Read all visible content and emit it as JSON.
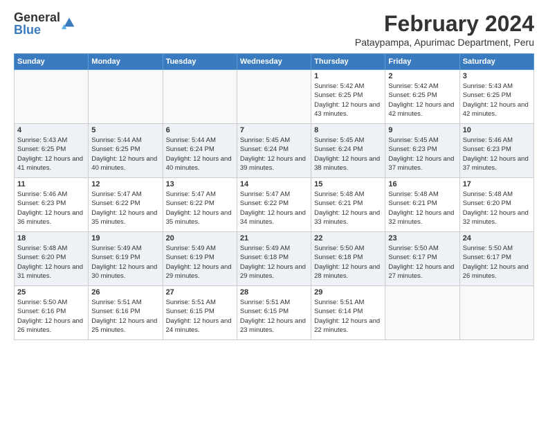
{
  "logo": {
    "general": "General",
    "blue": "Blue"
  },
  "title": "February 2024",
  "location": "Pataypampa, Apurimac Department, Peru",
  "days_of_week": [
    "Sunday",
    "Monday",
    "Tuesday",
    "Wednesday",
    "Thursday",
    "Friday",
    "Saturday"
  ],
  "weeks": [
    [
      {
        "day": "",
        "info": ""
      },
      {
        "day": "",
        "info": ""
      },
      {
        "day": "",
        "info": ""
      },
      {
        "day": "",
        "info": ""
      },
      {
        "day": "1",
        "info": "Sunrise: 5:42 AM\nSunset: 6:25 PM\nDaylight: 12 hours and 43 minutes."
      },
      {
        "day": "2",
        "info": "Sunrise: 5:42 AM\nSunset: 6:25 PM\nDaylight: 12 hours and 42 minutes."
      },
      {
        "day": "3",
        "info": "Sunrise: 5:43 AM\nSunset: 6:25 PM\nDaylight: 12 hours and 42 minutes."
      }
    ],
    [
      {
        "day": "4",
        "info": "Sunrise: 5:43 AM\nSunset: 6:25 PM\nDaylight: 12 hours and 41 minutes."
      },
      {
        "day": "5",
        "info": "Sunrise: 5:44 AM\nSunset: 6:25 PM\nDaylight: 12 hours and 40 minutes."
      },
      {
        "day": "6",
        "info": "Sunrise: 5:44 AM\nSunset: 6:24 PM\nDaylight: 12 hours and 40 minutes."
      },
      {
        "day": "7",
        "info": "Sunrise: 5:45 AM\nSunset: 6:24 PM\nDaylight: 12 hours and 39 minutes."
      },
      {
        "day": "8",
        "info": "Sunrise: 5:45 AM\nSunset: 6:24 PM\nDaylight: 12 hours and 38 minutes."
      },
      {
        "day": "9",
        "info": "Sunrise: 5:45 AM\nSunset: 6:23 PM\nDaylight: 12 hours and 37 minutes."
      },
      {
        "day": "10",
        "info": "Sunrise: 5:46 AM\nSunset: 6:23 PM\nDaylight: 12 hours and 37 minutes."
      }
    ],
    [
      {
        "day": "11",
        "info": "Sunrise: 5:46 AM\nSunset: 6:23 PM\nDaylight: 12 hours and 36 minutes."
      },
      {
        "day": "12",
        "info": "Sunrise: 5:47 AM\nSunset: 6:22 PM\nDaylight: 12 hours and 35 minutes."
      },
      {
        "day": "13",
        "info": "Sunrise: 5:47 AM\nSunset: 6:22 PM\nDaylight: 12 hours and 35 minutes."
      },
      {
        "day": "14",
        "info": "Sunrise: 5:47 AM\nSunset: 6:22 PM\nDaylight: 12 hours and 34 minutes."
      },
      {
        "day": "15",
        "info": "Sunrise: 5:48 AM\nSunset: 6:21 PM\nDaylight: 12 hours and 33 minutes."
      },
      {
        "day": "16",
        "info": "Sunrise: 5:48 AM\nSunset: 6:21 PM\nDaylight: 12 hours and 32 minutes."
      },
      {
        "day": "17",
        "info": "Sunrise: 5:48 AM\nSunset: 6:20 PM\nDaylight: 12 hours and 32 minutes."
      }
    ],
    [
      {
        "day": "18",
        "info": "Sunrise: 5:48 AM\nSunset: 6:20 PM\nDaylight: 12 hours and 31 minutes."
      },
      {
        "day": "19",
        "info": "Sunrise: 5:49 AM\nSunset: 6:19 PM\nDaylight: 12 hours and 30 minutes."
      },
      {
        "day": "20",
        "info": "Sunrise: 5:49 AM\nSunset: 6:19 PM\nDaylight: 12 hours and 29 minutes."
      },
      {
        "day": "21",
        "info": "Sunrise: 5:49 AM\nSunset: 6:18 PM\nDaylight: 12 hours and 29 minutes."
      },
      {
        "day": "22",
        "info": "Sunrise: 5:50 AM\nSunset: 6:18 PM\nDaylight: 12 hours and 28 minutes."
      },
      {
        "day": "23",
        "info": "Sunrise: 5:50 AM\nSunset: 6:17 PM\nDaylight: 12 hours and 27 minutes."
      },
      {
        "day": "24",
        "info": "Sunrise: 5:50 AM\nSunset: 6:17 PM\nDaylight: 12 hours and 26 minutes."
      }
    ],
    [
      {
        "day": "25",
        "info": "Sunrise: 5:50 AM\nSunset: 6:16 PM\nDaylight: 12 hours and 26 minutes."
      },
      {
        "day": "26",
        "info": "Sunrise: 5:51 AM\nSunset: 6:16 PM\nDaylight: 12 hours and 25 minutes."
      },
      {
        "day": "27",
        "info": "Sunrise: 5:51 AM\nSunset: 6:15 PM\nDaylight: 12 hours and 24 minutes."
      },
      {
        "day": "28",
        "info": "Sunrise: 5:51 AM\nSunset: 6:15 PM\nDaylight: 12 hours and 23 minutes."
      },
      {
        "day": "29",
        "info": "Sunrise: 5:51 AM\nSunset: 6:14 PM\nDaylight: 12 hours and 22 minutes."
      },
      {
        "day": "",
        "info": ""
      },
      {
        "day": "",
        "info": ""
      }
    ]
  ]
}
